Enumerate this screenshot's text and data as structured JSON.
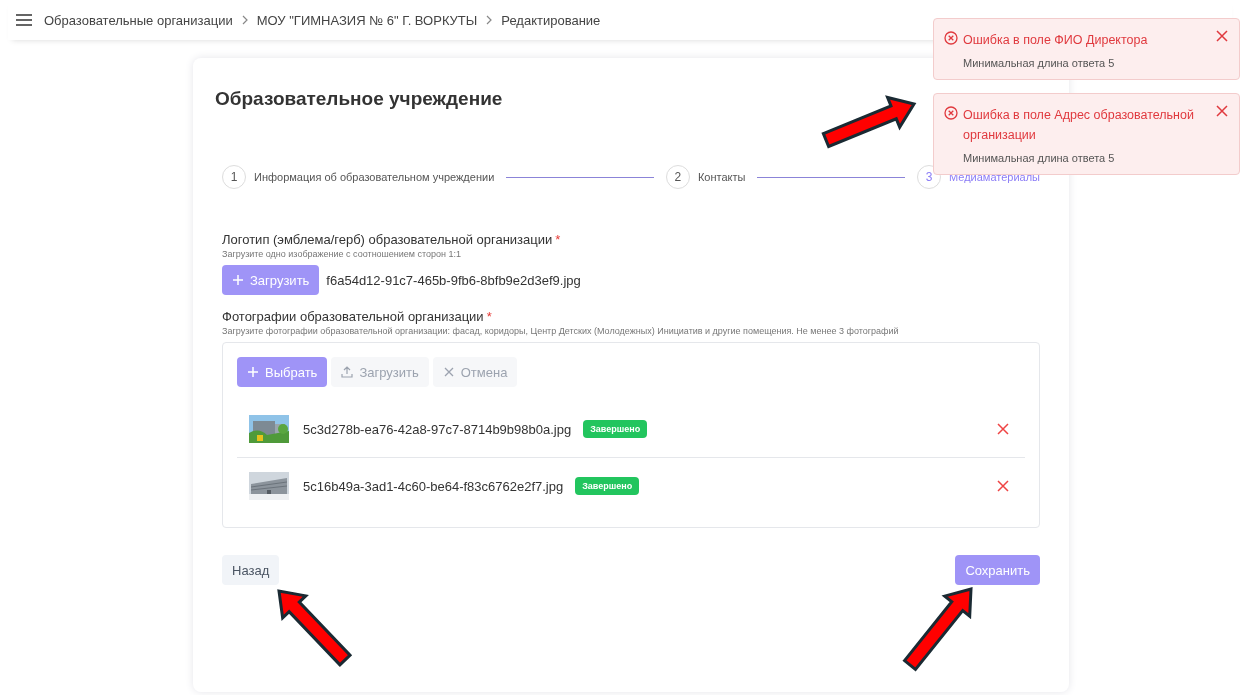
{
  "breadcrumbs": [
    {
      "label": "Образовательные организации"
    },
    {
      "label": "МОУ \"ГИМНАЗИЯ № 6\" Г. ВОРКУТЫ"
    },
    {
      "label": "Редактирование"
    }
  ],
  "card": {
    "title": "Образовательное учреждение"
  },
  "steps": [
    {
      "number": "1",
      "label": "Информация об образовательном учреждении",
      "selected": false
    },
    {
      "number": "2",
      "label": "Контакты",
      "selected": false
    },
    {
      "number": "3",
      "label": "Медиаматериалы",
      "selected": true
    }
  ],
  "logo_field": {
    "label": "Логотип (эмблема/герб) образовательной организации",
    "required_mark": "*",
    "hint": "Загрузите одно изображение с соотношением сторон 1:1",
    "upload_button": "Загрузить",
    "file_name": "f6a54d12-91c7-465b-9fb6-8bfb9e2d3ef9.jpg"
  },
  "photos_field": {
    "label": "Фотографии образовательной организации",
    "required_mark": "*",
    "hint": "Загрузите фотографии образовательной организации: фасад, коридоры, Центр Детских (Молодежных) Инициатив и другие помещения. Не менее 3 фотографий",
    "toolbar": [
      {
        "label": "Выбрать",
        "kind": "add",
        "disabled": false
      },
      {
        "label": "Загрузить",
        "kind": "upload",
        "disabled": true
      },
      {
        "label": "Отмена",
        "kind": "cancel",
        "disabled": true
      }
    ],
    "files": [
      {
        "name": "5c3d278b-ea76-42a8-97c7-8714b9b98b0a.jpg",
        "status": "Завершено",
        "kind": "picture"
      },
      {
        "name": "5c16b49a-3ad1-4c60-be64-f83c6762e2f7.jpg",
        "status": "Завершено",
        "kind": "picture"
      }
    ]
  },
  "footer": {
    "back_button": "Назад",
    "save_button": "Сохранить"
  },
  "toasts": [
    {
      "title": "Ошибка в поле ФИО Директора",
      "message": "Минимальная длина ответа 5"
    },
    {
      "title": "Ошибка в поле Адрес образовательной организации",
      "message": "Минимальная длина ответа 5"
    }
  ]
}
